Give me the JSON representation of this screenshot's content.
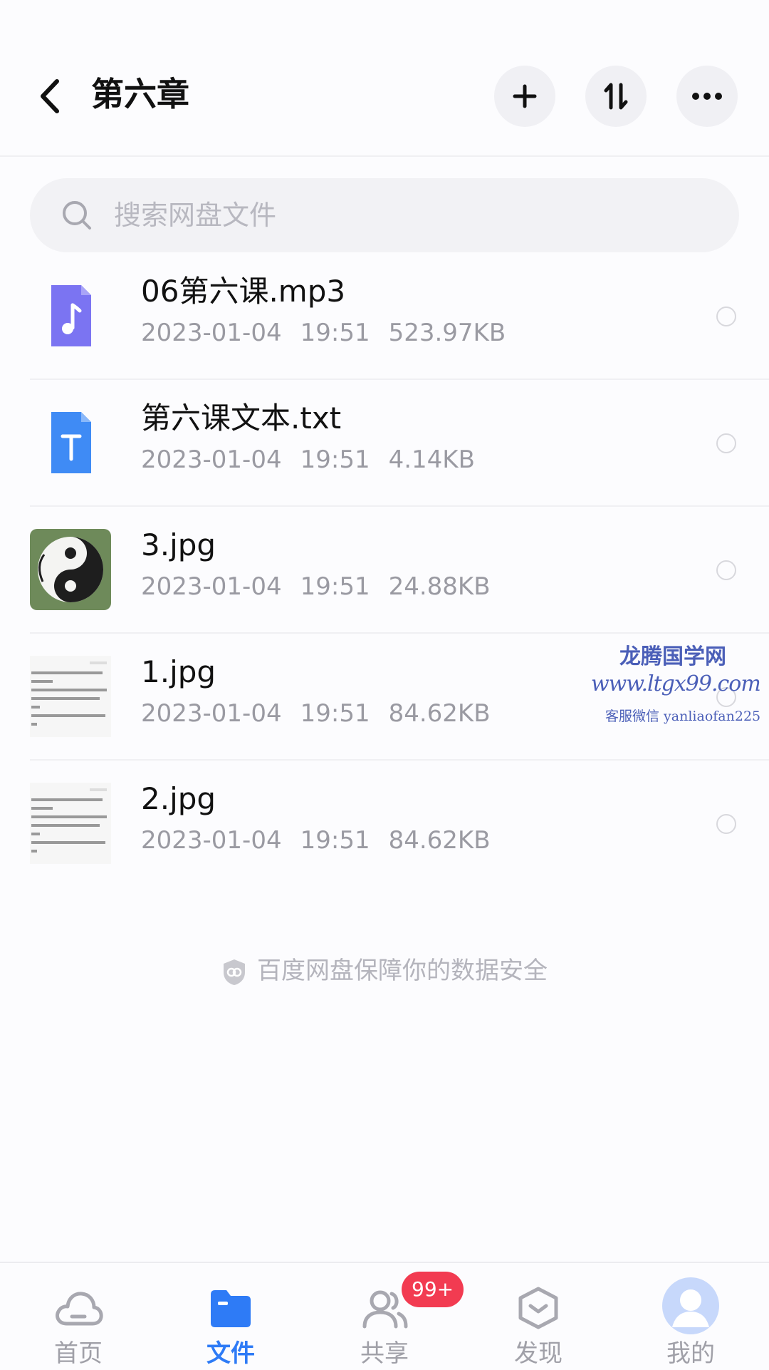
{
  "header": {
    "title": "第六章",
    "back_icon": "chevron-left-icon",
    "actions": [
      {
        "name": "add-button",
        "icon": "plus-icon"
      },
      {
        "name": "sort-button",
        "icon": "sort-icon"
      },
      {
        "name": "more-button",
        "icon": "ellipsis-icon"
      }
    ]
  },
  "search": {
    "placeholder": "搜索网盘文件"
  },
  "files": [
    {
      "name": "06第六课.mp3",
      "date": "2023-01-04",
      "time": "19:51",
      "size": "523.97KB",
      "type": "audio",
      "icon_color": "#7b74f2"
    },
    {
      "name": "第六课文本.txt",
      "date": "2023-01-04",
      "time": "19:51",
      "size": "4.14KB",
      "type": "text",
      "icon_color": "#3f8bf5"
    },
    {
      "name": "3.jpg",
      "date": "2023-01-04",
      "time": "19:51",
      "size": "24.88KB",
      "type": "image-yinyang"
    },
    {
      "name": "1.jpg",
      "date": "2023-01-04",
      "time": "19:51",
      "size": "84.62KB",
      "type": "image-doc"
    },
    {
      "name": "2.jpg",
      "date": "2023-01-04",
      "time": "19:51",
      "size": "84.62KB",
      "type": "image-doc"
    }
  ],
  "watermark": {
    "line1": "龙腾国学网",
    "line2": "www.ltgx99.com",
    "line3": "客服微信 yanliaofan225",
    "color": "#4b5fb8"
  },
  "security_note": "百度网盘保障你的数据安全",
  "tabbar": {
    "active_color": "#2e7bf6",
    "items": [
      {
        "label": "首页",
        "icon": "cloud-icon",
        "active": false
      },
      {
        "label": "文件",
        "icon": "folder-icon",
        "active": true
      },
      {
        "label": "共享",
        "icon": "people-icon",
        "active": false,
        "badge": "99+"
      },
      {
        "label": "发现",
        "icon": "hexagon-icon",
        "active": false
      },
      {
        "label": "我的",
        "icon": "avatar-icon",
        "active": false
      }
    ]
  }
}
